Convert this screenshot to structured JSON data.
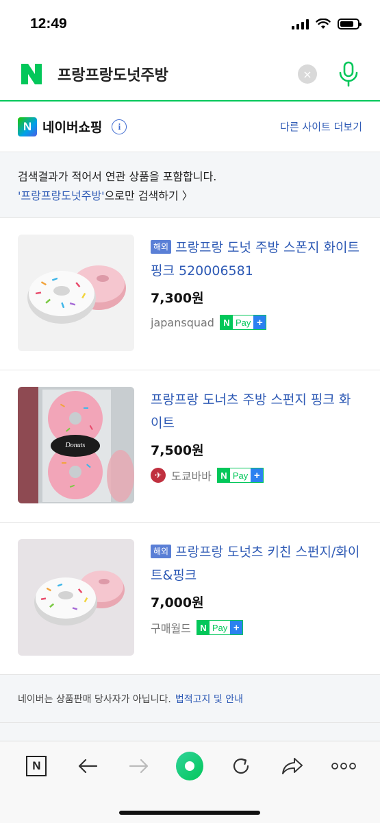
{
  "status": {
    "time": "12:49"
  },
  "search": {
    "query": "프랑프랑도넛주방",
    "clear_icon": "×"
  },
  "shopping": {
    "title": "네이버쇼핑",
    "more_sites": "다른 사이트 더보기"
  },
  "notice": {
    "line1": "검색결과가 적어서 연관 상품을 포함합니다.",
    "query_quoted": "'프랑프랑도넛주방'",
    "link_suffix": "으로만 검색하기 〉"
  },
  "products": [
    {
      "badge": "해외",
      "title": "프랑프랑 도넛 주방 스폰지 화이트 핑크 520006581",
      "price": "7,300원",
      "seller": "japansquad",
      "npay": "Pay"
    },
    {
      "badge": "",
      "title": "프랑프랑 도너츠 주방 스펀지 핑크 화이트",
      "price": "7,500원",
      "seller": "도쿄바바",
      "npay": "Pay",
      "package_label": "Donuts"
    },
    {
      "badge": "해외",
      "title": "프랑프랑 도넛츠 키친 스펀지/화이트&핑크",
      "price": "7,000원",
      "seller": "구매월드",
      "npay": "Pay"
    }
  ],
  "disclaimer": {
    "text": "네이버는 상품판매 당사자가 아닙니다.",
    "link": "법적고지 및 안내"
  },
  "colors": {
    "accent_green": "#03c75a",
    "link_blue": "#2e5ab5"
  }
}
